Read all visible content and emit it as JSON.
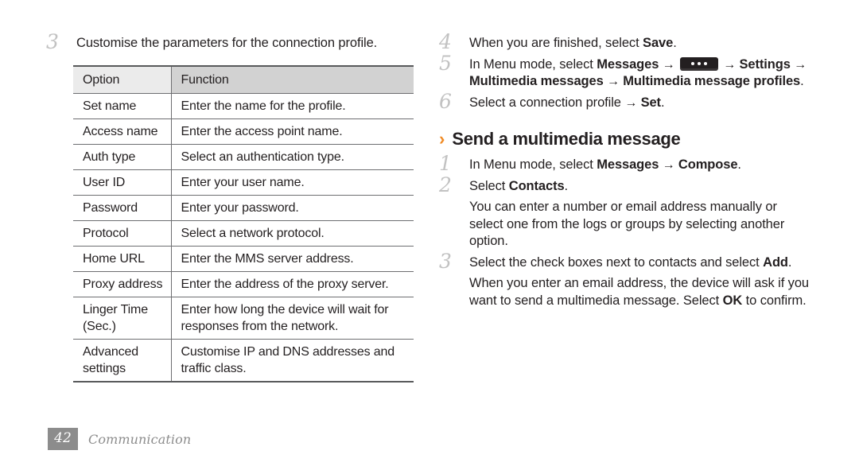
{
  "footer": {
    "page_number": "42",
    "section_label": "Communication"
  },
  "colors": {
    "accent_orange": "#f08a24",
    "step_number_gray": "#c2c2c2",
    "header_option_bg": "#ebebeb",
    "header_function_bg": "#d2d2d2",
    "footer_gray": "#8c8c8c",
    "text": "#231f20"
  },
  "left_column": {
    "step3": {
      "number": "3",
      "text": "Customise the parameters for the connection profile."
    },
    "table": {
      "headers": [
        "Option",
        "Function"
      ],
      "rows": [
        {
          "option": "Set name",
          "function": "Enter the name for the profile."
        },
        {
          "option": "Access name",
          "function": "Enter the access point name."
        },
        {
          "option": "Auth type",
          "function": "Select an authentication type."
        },
        {
          "option": "User ID",
          "function": "Enter your user name."
        },
        {
          "option": "Password",
          "function": "Enter your password."
        },
        {
          "option": "Protocol",
          "function": "Select a network protocol."
        },
        {
          "option": "Home URL",
          "function": "Enter the MMS server address."
        },
        {
          "option": "Proxy address",
          "function": "Enter the address of the proxy server."
        },
        {
          "option": "Linger Time (Sec.)",
          "function": "Enter how long the device will wait for responses from the network."
        },
        {
          "option": "Advanced settings",
          "function": "Customise IP and DNS addresses and traffic class."
        }
      ]
    }
  },
  "right_column": {
    "step4": {
      "number": "4",
      "prefix": "When you are finished, select ",
      "bold": "Save",
      "suffix": "."
    },
    "step5": {
      "number": "5",
      "t1": "In Menu mode, select ",
      "b1": "Messages",
      "a1": " → ",
      "icon": "menu-key-icon",
      "a2": " → ",
      "b2": "Settings",
      "a3": " → ",
      "b3": "Multimedia messages",
      "a4": " → ",
      "b4": "Multimedia message profiles",
      "suffix": "."
    },
    "step6": {
      "number": "6",
      "prefix": "Select a connection profile ",
      "arrow": "→ ",
      "bold": "Set",
      "suffix": "."
    },
    "section": {
      "chevron": "›",
      "title": "Send a multimedia message"
    },
    "step1": {
      "number": "1",
      "prefix": "In Menu mode, select ",
      "bold1": "Messages",
      "arrow": " → ",
      "bold2": "Compose",
      "suffix": "."
    },
    "step2": {
      "number": "2",
      "prefix": "Select ",
      "bold": "Contacts",
      "suffix": ".",
      "note": "You can enter a number or email address manually or select one from the logs or groups by selecting another option."
    },
    "step3": {
      "number": "3",
      "prefix": "Select the check boxes next to contacts and select ",
      "bold": "Add",
      "suffix": ".",
      "note_prefix": "When you enter an email address, the device will ask if you want to send a multimedia message. Select ",
      "note_bold": "OK",
      "note_suffix": " to confirm."
    }
  }
}
